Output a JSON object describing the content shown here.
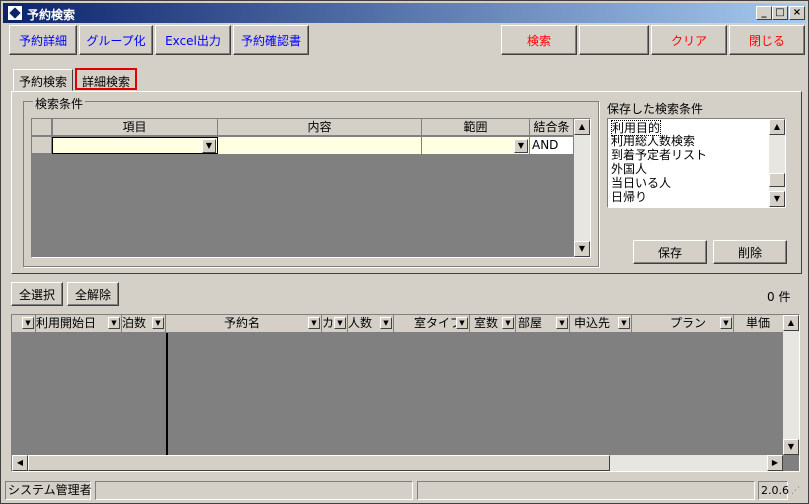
{
  "window": {
    "title": "予約検索"
  },
  "toolbar": {
    "reservation_detail": "予約詳細",
    "group": "グループ化",
    "excel": "Excel出力",
    "confirmation": "予約確認書",
    "search": "検索",
    "clear": "クリア",
    "close": "閉じる"
  },
  "tabs": {
    "simple": "予約検索",
    "detail": "詳細検索"
  },
  "conditions": {
    "group_label": "検索条件",
    "headers": {
      "item": "項目",
      "content": "内容",
      "range": "範囲",
      "join": "結合条"
    },
    "row": {
      "item": "",
      "content": "",
      "range": "",
      "join": "AND"
    }
  },
  "saved": {
    "label": "保存した検索条件",
    "items": [
      "利用目的",
      "利用総人数検索",
      "到着予定者リスト",
      "外国人",
      "当日いる人",
      "日帰り"
    ],
    "save_button": "保存",
    "delete_button": "削除"
  },
  "results": {
    "select_all": "全選択",
    "deselect_all": "全解除",
    "count": "0 件",
    "columns": [
      "利用開始日",
      "泊数",
      "予約名",
      "カ",
      "人数",
      "室タイプ",
      "室数",
      "部屋",
      "申込先",
      "プラン",
      "単価"
    ]
  },
  "status": {
    "user": "システム管理者",
    "version": "2.0.6"
  }
}
